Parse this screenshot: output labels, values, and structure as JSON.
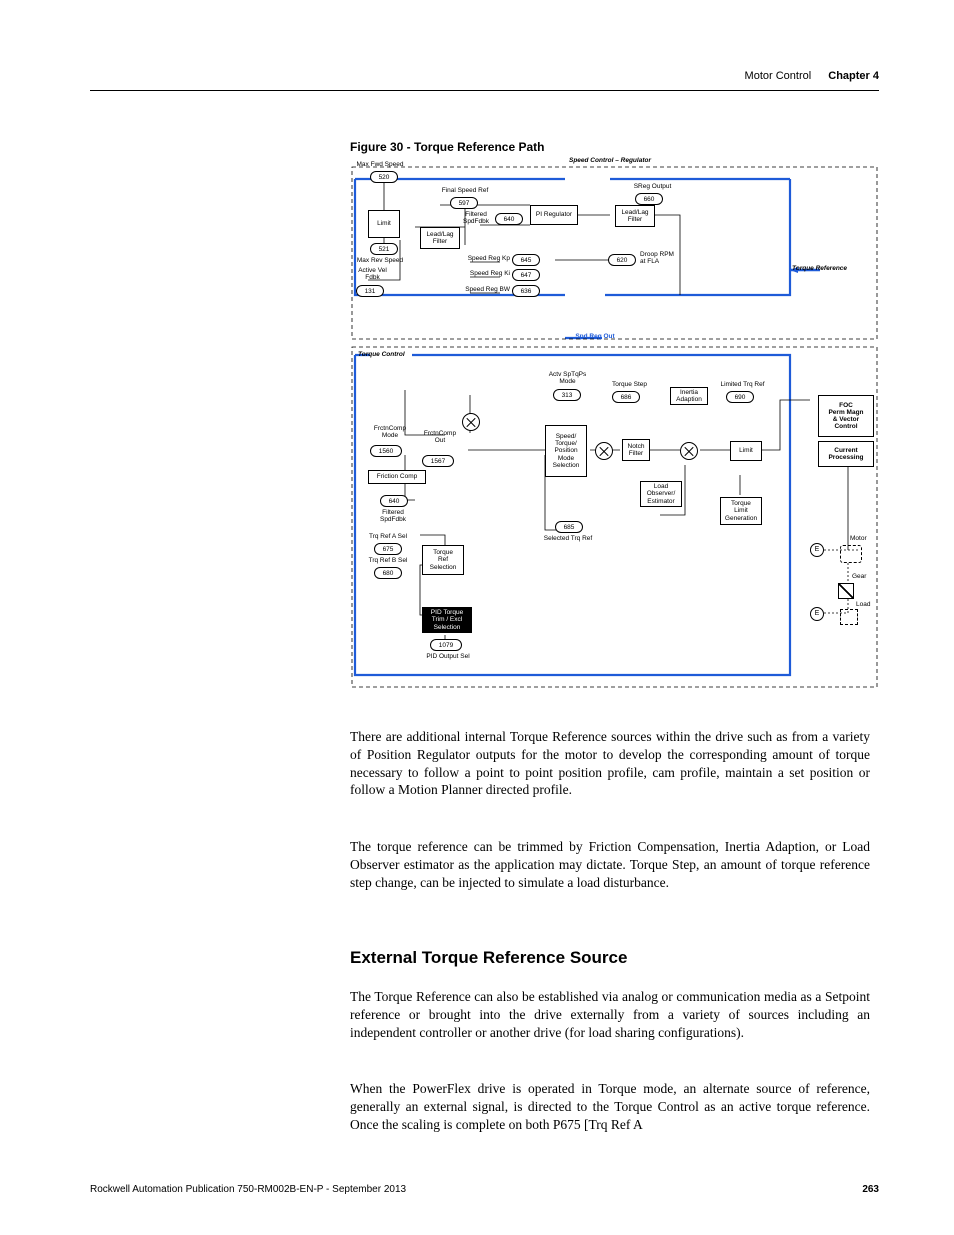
{
  "header": {
    "section": "Motor Control",
    "chapter": "Chapter 4"
  },
  "figure_caption": "Figure 30 - Torque Reference Path",
  "diagram": {
    "speed_section_title": "Speed Control – Regulator",
    "torque_section_title": "Torque Control",
    "labels": {
      "max_fwd_speed": "Max Fwd Speed",
      "max_rev_speed": "Max Rev Speed",
      "active_vel_fdbk": "Active Vel\nFdbk",
      "final_speed_ref": "Final Speed Ref",
      "filtered_spdfdbk": "Filtered\nSpdFdbk",
      "speed_reg_kp": "Speed Reg Kp",
      "speed_reg_ki": "Speed Reg Ki",
      "speed_reg_bw": "Speed Reg BW",
      "sreg_output": "SReg Output",
      "droop": "Droop RPM\nat FLA",
      "torque_reference": "Torque Reference",
      "spd_reg_out": "Spd Reg Out",
      "actv_sptqps_mode": "Actv SpTqPs\nMode",
      "torque_step": "Torque Step",
      "limited_trq_ref": "Limited Trq Ref",
      "frctncomp_mode": "FrctnComp\nMode",
      "frctncomp_out": "FrctnComp\nOut",
      "selected_trq_ref": "Selected Trq Ref",
      "trq_ref_a_sel": "Trq Ref A Sel",
      "trq_ref_b_sel": "Trq Ref B Sel",
      "pid_output_sel": "PID Output Sel",
      "motor": "Motor",
      "gear": "Gear",
      "load": "Load"
    },
    "boxes": {
      "limit1": "Limit",
      "leadlag1": "Lead/Lag\nFilter",
      "pi_regulator": "PI Regulator",
      "leadlag2": "Lead/Lag\nFilter",
      "friction_comp": "Friction Comp",
      "sptq_mode_sel": "Speed/\nTorque/\nPosition\nMode\nSelection",
      "notch_filter": "Notch\nFilter",
      "inertia_adaption": "Inertia\nAdaption",
      "limit2": "Limit",
      "load_obs": "Load\nObserver/\nEstimator",
      "torque_limit_gen": "Torque\nLimit\nGeneration",
      "torque_ref_sel": "Torque\nRef\nSelection",
      "pid_trim": "PID Torque\nTrim / Excl\nSelection",
      "foc": "FOC\nPerm Magn\n& Vector\nControl",
      "current_proc": "Current\nProcessing"
    },
    "params": {
      "p520": "520",
      "p521": "521",
      "p131": "131",
      "p597": "597",
      "p640a": "640",
      "p645": "645",
      "p647": "647",
      "p636": "636",
      "p660": "660",
      "p620": "620",
      "p313": "313",
      "p686": "686",
      "p690": "690",
      "p1560": "1560",
      "p1567": "1567",
      "p640b": "640",
      "p685": "685",
      "p675": "675",
      "p680": "680",
      "p1079": "1079"
    }
  },
  "para1": "There are additional internal Torque Reference sources within the drive such as from a variety of Position Regulator outputs for the motor to develop the corresponding amount of torque necessary to follow a point to point position profile, cam profile, maintain a set position or follow a Motion Planner directed profile.",
  "para2": "The torque reference can be trimmed by Friction Compensation, Inertia Adaption, or Load Observer estimator as the application may dictate. Torque Step, an amount of torque reference step change, can be injected to simulate a load disturbance.",
  "h2": "External Torque Reference Source",
  "para3": "The Torque Reference can also be established via analog or communication media as a Setpoint reference or brought into the drive externally from a variety of sources including an independent controller or another drive (for load sharing configurations).",
  "para4": "When the PowerFlex drive is operated in Torque mode, an alternate source of reference, generally an external signal, is directed to the Torque Control as an active torque reference. Once the scaling is complete on both P675 [Trq Ref A",
  "footer": {
    "pub": "Rockwell Automation Publication 750-RM002B-EN-P - September 2013",
    "page": "263"
  }
}
